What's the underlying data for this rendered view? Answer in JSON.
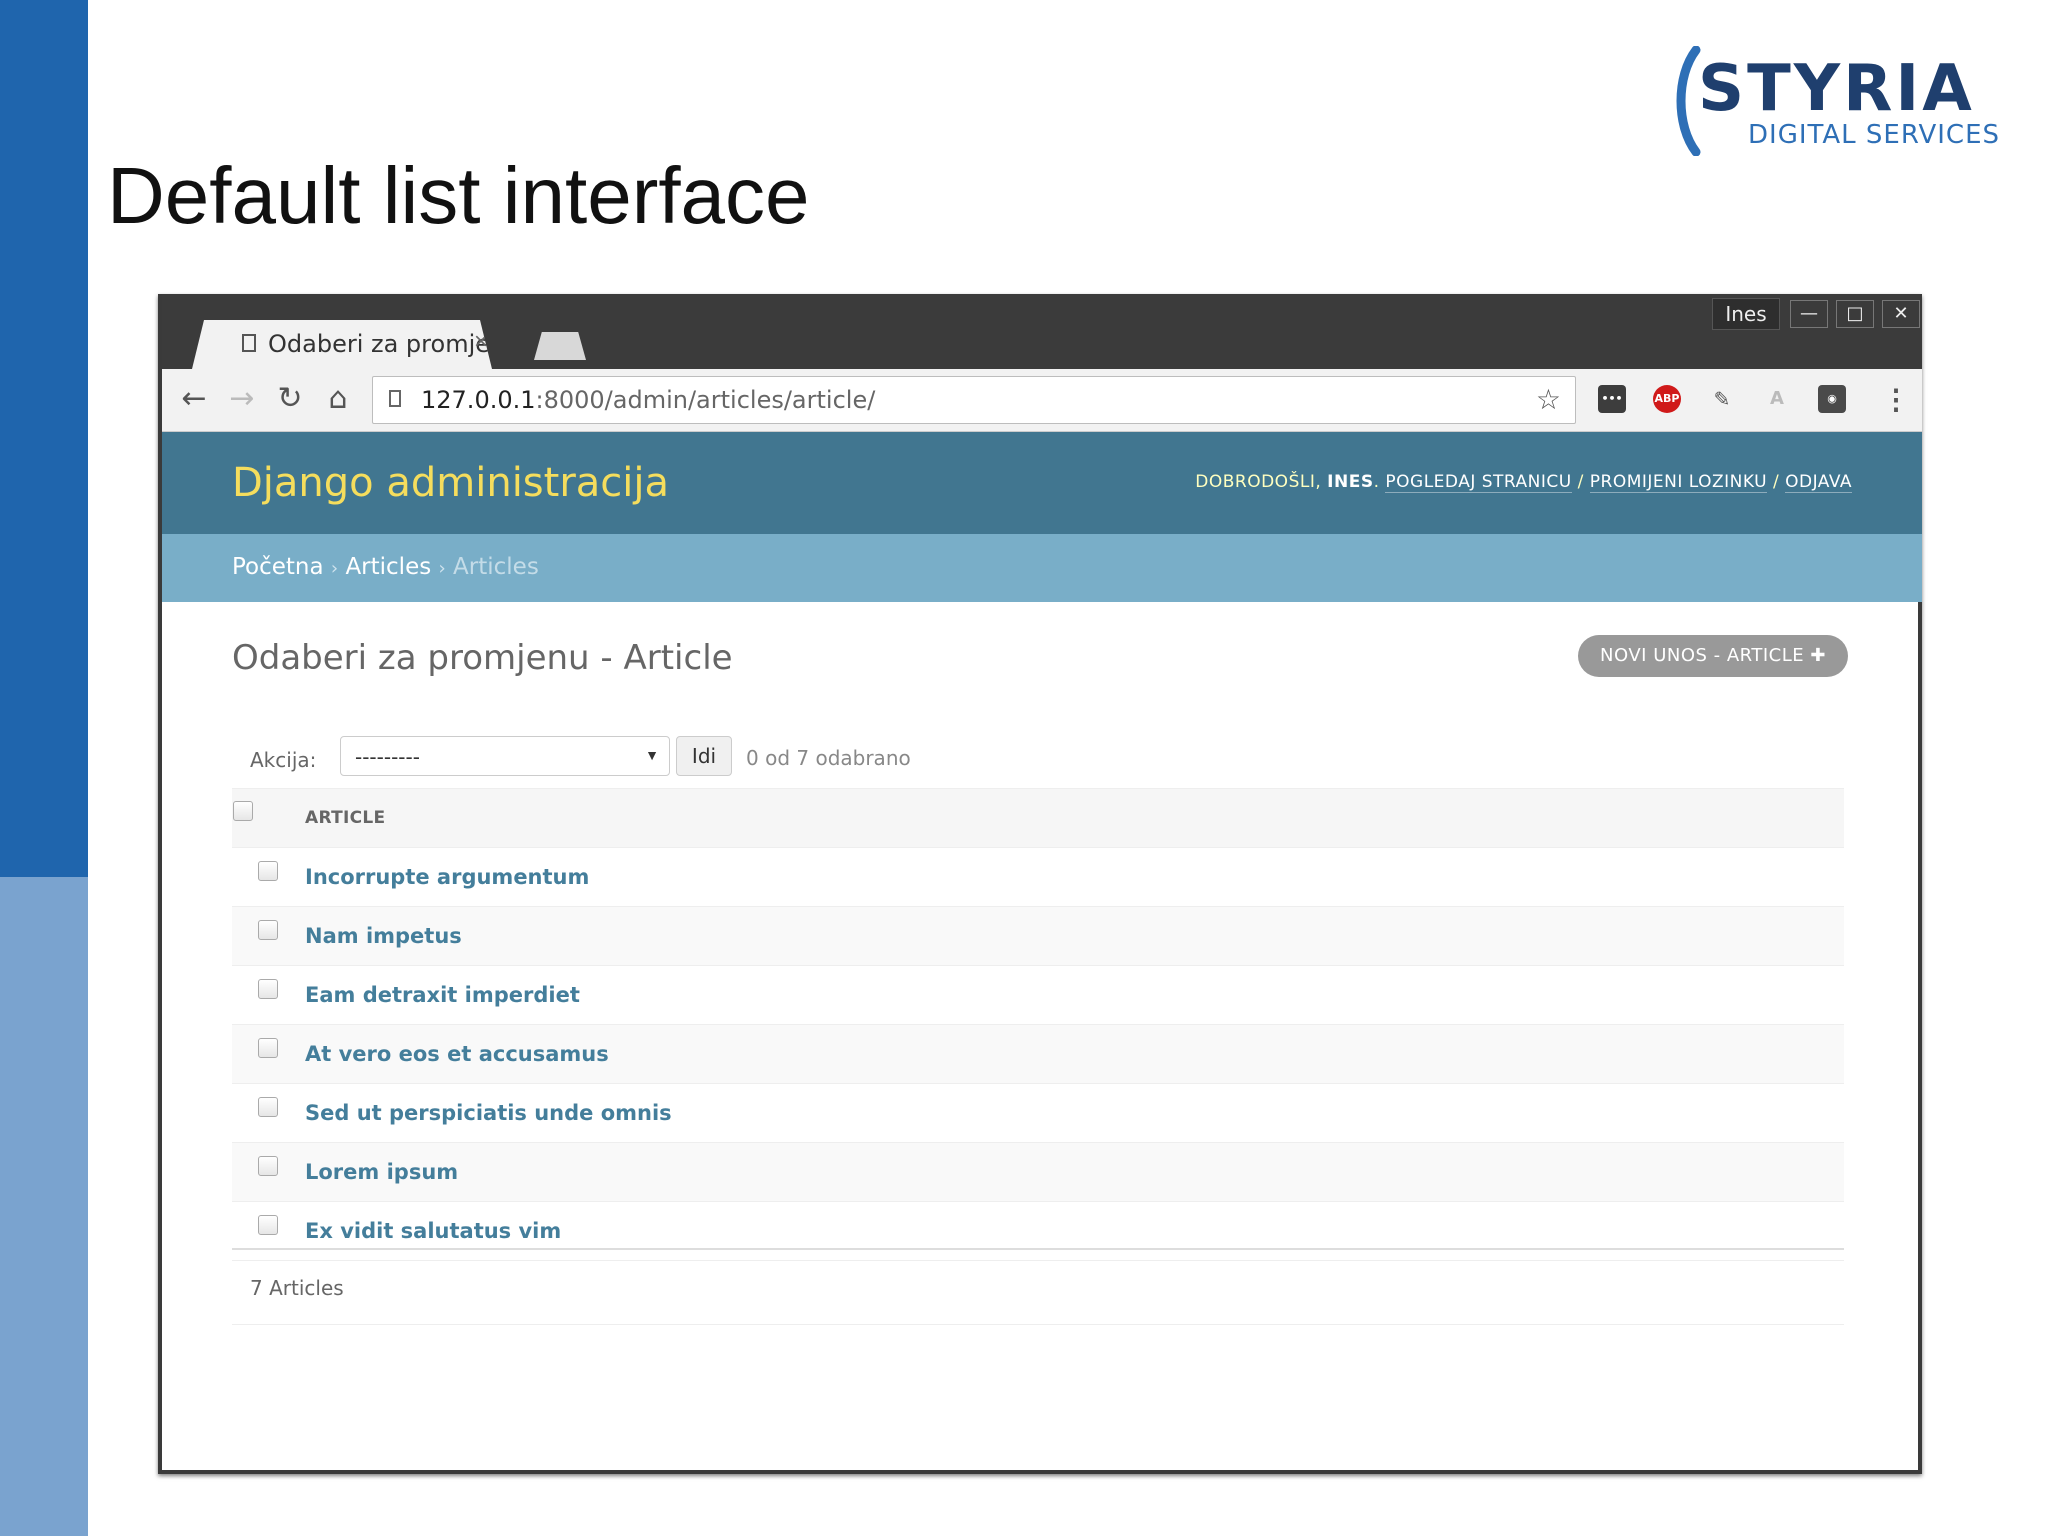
{
  "slide": {
    "title": "Default list interface",
    "logo_word": "STYRIA",
    "logo_sub": "DIGITAL SERVICES",
    "colors": {
      "sidebar_dark": "#1f65ad",
      "sidebar_light": "#7aa3cf"
    }
  },
  "browser": {
    "tab_title": "Odaberi za promjer",
    "tab_close": "×",
    "user": "Ines",
    "window_buttons": {
      "minimize": "—",
      "maximize": "□",
      "close": "✕"
    },
    "nav": {
      "back": "←",
      "forward": "→",
      "reload": "↻",
      "home": "⌂"
    },
    "url_host": "127.0.0.1",
    "url_path": ":8000/admin/articles/article/",
    "star": "☆",
    "extensions": [
      {
        "name": "lastpass-icon",
        "label": "•••",
        "color": "#3d3d3d"
      },
      {
        "name": "adblock-icon",
        "label": "ABP",
        "color": "#d01a1a"
      },
      {
        "name": "extension-icon",
        "label": "✎",
        "color": "#9a9a9a"
      },
      {
        "name": "translate-icon",
        "label": "A",
        "color": "#c8c8c8"
      },
      {
        "name": "privacy-icon",
        "label": "◉",
        "color": "#4a4a4a"
      }
    ],
    "menu": "⋮"
  },
  "admin": {
    "branding": "Django administracija",
    "user_tools": {
      "welcome": "DOBRODOŠLI,",
      "username": "INES",
      "view_site": "POGLEDAJ STRANICU",
      "sep": " / ",
      "change_password": "PROMIJENI LOZINKU",
      "logout": "ODJAVA"
    },
    "breadcrumbs": {
      "home": "Početna",
      "app": "Articles",
      "model": "Articles",
      "sep": "›"
    },
    "content_title": "Odaberi za promjenu - Article",
    "add_button": "NOVI UNOS - ARTICLE ✚",
    "actions": {
      "label": "Akcija:",
      "selected": "---------",
      "go": "Idi",
      "counter": "0 od 7 odabrano"
    },
    "table": {
      "header": "ARTICLE",
      "rows": [
        "Incorrupte argumentum",
        "Nam impetus",
        "Eam detraxit imperdiet",
        "At vero eos et accusamus",
        "Sed ut perspiciatis unde omnis",
        "Lorem ipsum",
        "Ex vidit salutatus vim"
      ]
    },
    "paginator": "7 Articles",
    "colors": {
      "header": "#417690",
      "breadcrumbs": "#79aec8",
      "branding": "#f5dd5d",
      "link": "#447e9b"
    }
  }
}
